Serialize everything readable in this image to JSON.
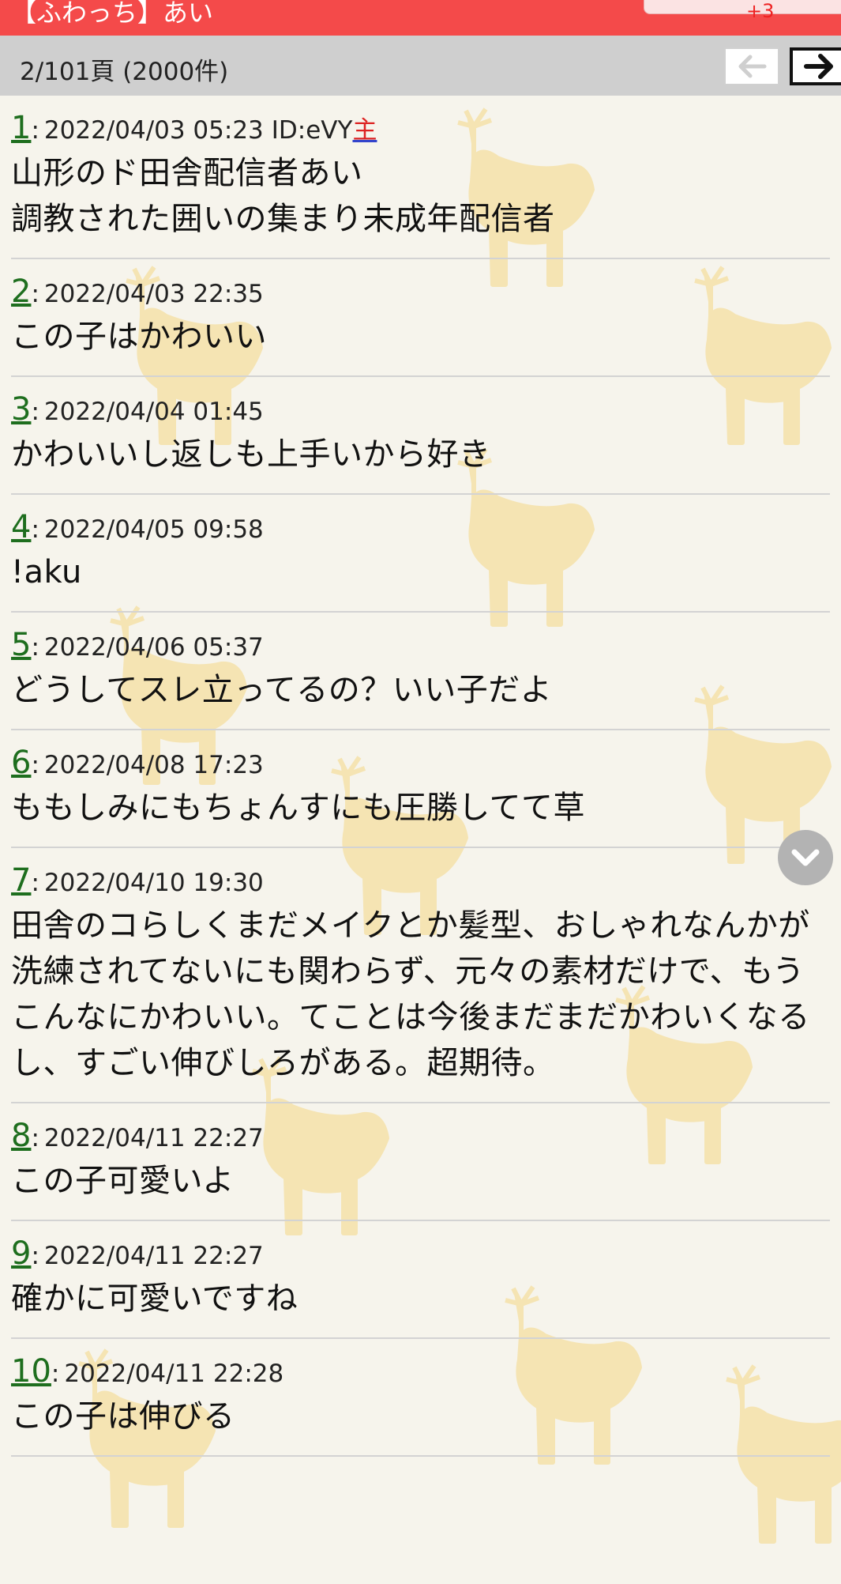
{
  "header": {
    "title": "【ふわっち】あい",
    "badge_text": "",
    "badge_delta": "+3"
  },
  "pager": {
    "info": "2/101頁 (2000件)",
    "prev_icon": "arrow-left-icon",
    "next_icon": "arrow-right-icon"
  },
  "posts": [
    {
      "num": "1",
      "date": "2022/04/03 05:23",
      "id": "ID:eVY",
      "op": "主",
      "body": "山形のド田舎配信者あい\n調教された囲いの集まり未成年配信者"
    },
    {
      "num": "2",
      "date": "2022/04/03 22:35",
      "id": "",
      "op": "",
      "body": "この子はかわいい"
    },
    {
      "num": "3",
      "date": "2022/04/04 01:45",
      "id": "",
      "op": "",
      "body": "かわいいし返しも上手いから好き"
    },
    {
      "num": "4",
      "date": "2022/04/05 09:58",
      "id": "",
      "op": "",
      "body": "!aku"
    },
    {
      "num": "5",
      "date": "2022/04/06 05:37",
      "id": "",
      "op": "",
      "body": "どうしてスレ立ってるの？いい子だよ"
    },
    {
      "num": "6",
      "date": "2022/04/08 17:23",
      "id": "",
      "op": "",
      "body": "ももしみにもちょんすにも圧勝してて草"
    },
    {
      "num": "7",
      "date": "2022/04/10 19:30",
      "id": "",
      "op": "",
      "body": "田舎のコらしくまだメイクとか髪型、おしゃれなんかが洗練されてないにも関わらず、元々の素材だけで、もうこんなにかわいい。てことは今後まだまだかわいくなるし、すごい伸びしろがある。超期待。"
    },
    {
      "num": "8",
      "date": "2022/04/11 22:27",
      "id": "",
      "op": "",
      "body": "この子可愛いよ"
    },
    {
      "num": "9",
      "date": "2022/04/11 22:27",
      "id": "",
      "op": "",
      "body": "確かに可愛いですね"
    },
    {
      "num": "10",
      "date": "2022/04/11 22:28",
      "id": "",
      "op": "",
      "body": "この子は伸びる"
    }
  ],
  "scroll_button": {
    "icon": "chevron-down-icon"
  },
  "colors": {
    "header_red": "#f44a4a",
    "pager_gray": "#cfcfcf",
    "post_number_green": "#1e6e1e",
    "op_red": "#dd2222",
    "pattern_yellow": "#f5dfa0"
  }
}
